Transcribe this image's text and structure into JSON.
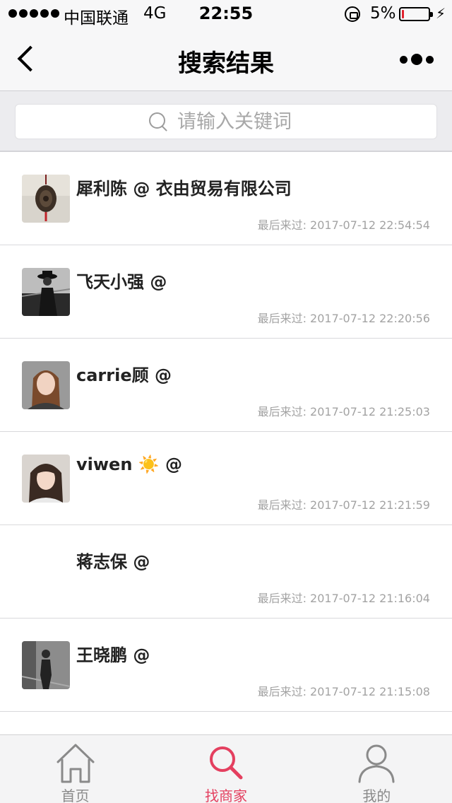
{
  "status_bar": {
    "carrier": "中国联通",
    "network": "4G",
    "time": "22:55",
    "battery": "5%",
    "battery_level": 0.05
  },
  "nav": {
    "title": "搜索结果"
  },
  "search": {
    "placeholder": "请输入关键词"
  },
  "results": [
    {
      "name": "犀利陈 @ 衣由贸易有限公司",
      "last_visit": "最后来过: 2017-07-12 22:54:54"
    },
    {
      "name": "飞天小强 @",
      "last_visit": "最后来过: 2017-07-12 22:20:56"
    },
    {
      "name": "carrie顾 @",
      "last_visit": "最后来过: 2017-07-12 21:25:03"
    },
    {
      "name": "viwen ☀️ @",
      "last_visit": "最后来过: 2017-07-12 21:21:59"
    },
    {
      "name": "蒋志保 @",
      "last_visit": "最后来过: 2017-07-12 21:16:04"
    },
    {
      "name": "王晓鹏 @",
      "last_visit": "最后来过: 2017-07-12 21:15:08"
    }
  ],
  "tabs": [
    {
      "label": "首页",
      "icon": "home-icon"
    },
    {
      "label": "找商家",
      "icon": "search-icon"
    },
    {
      "label": "我的",
      "icon": "user-icon"
    }
  ],
  "colors": {
    "accent": "#e43f5f",
    "tab_inactive": "#8a8a8a",
    "timestamp": "#a3a3a3"
  }
}
